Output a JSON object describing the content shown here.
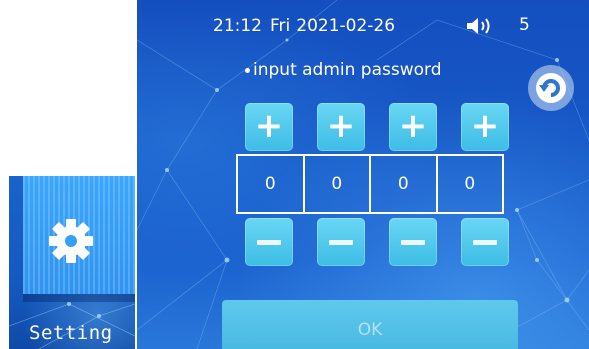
{
  "side_panel": {
    "icon": "gear-icon",
    "label": "Setting"
  },
  "status_bar": {
    "time": "21:12",
    "day": "Fri",
    "date": "2021-02-26",
    "speaker_icon": "speaker-icon",
    "volume": "5"
  },
  "prompt": "input admin password",
  "refresh_icon": "refresh-icon",
  "password": {
    "plus_label": "+",
    "digits": [
      "0",
      "0",
      "0",
      "0"
    ]
  },
  "ok_label": "OK",
  "colors": {
    "background": "#1657c6",
    "button": "#4cc6ec",
    "text": "#ffffff"
  }
}
